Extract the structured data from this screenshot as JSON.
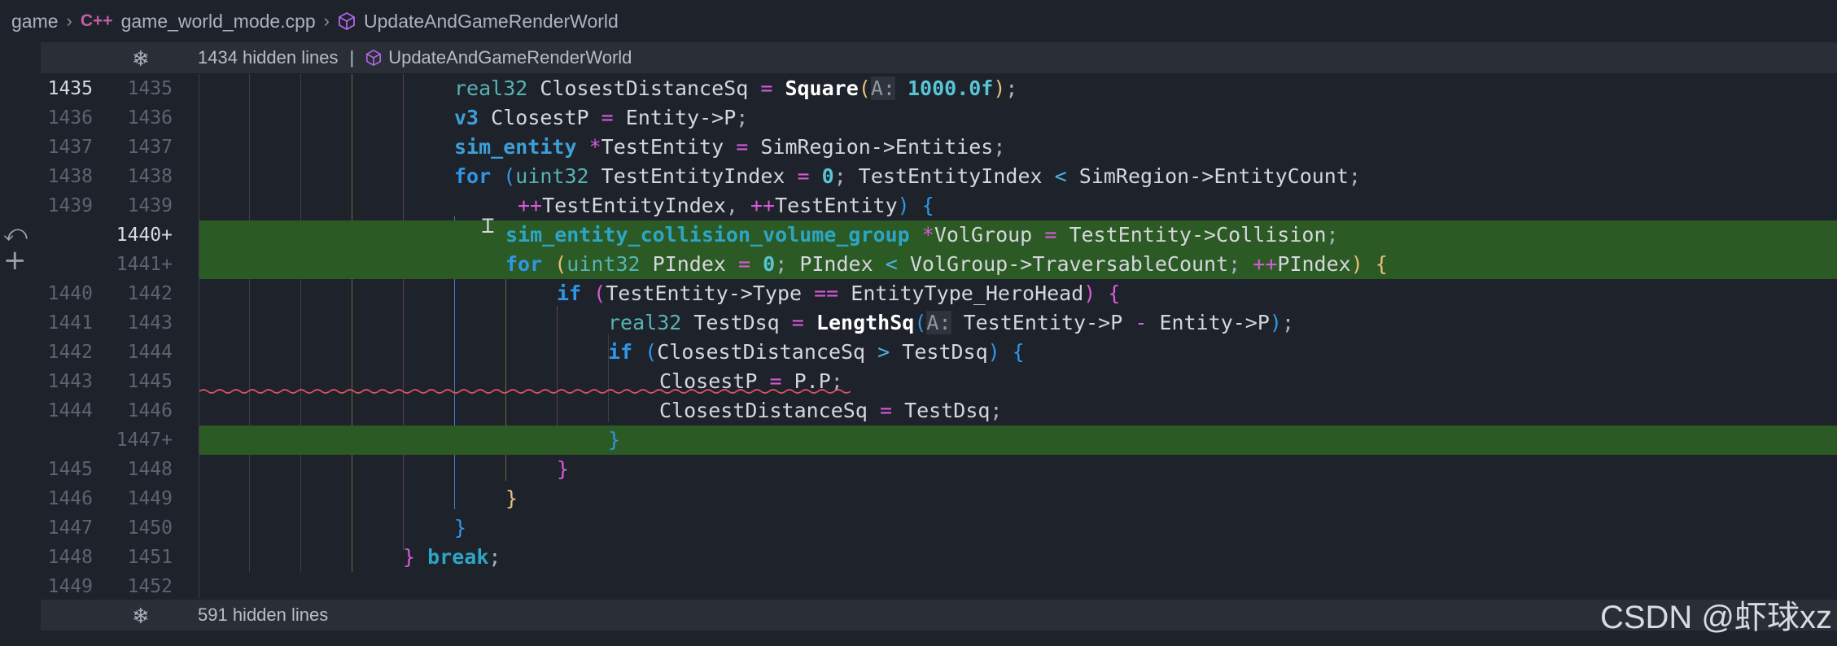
{
  "breadcrumb": {
    "folder": "game",
    "file_icon": "C++",
    "file": "game_world_mode.cpp",
    "symbol": "UpdateAndGameRenderWorld"
  },
  "top_fold": {
    "count_text": "1434 hidden lines",
    "separator": "|",
    "symbol": "UpdateAndGameRenderWorld"
  },
  "bottom_fold": {
    "count_text": "591 hidden lines"
  },
  "gutter_icons": [
    "revert-icon",
    "add-icon"
  ],
  "lines": [
    {
      "old": "1435",
      "new": "1435",
      "added": false,
      "current": true,
      "code": "real32 ClosestDistanceSq = Square(A: 1000.0f);"
    },
    {
      "old": "1436",
      "new": "1436",
      "added": false,
      "code": "v3 ClosestP = Entity->P;"
    },
    {
      "old": "1437",
      "new": "1437",
      "added": false,
      "code": "sim_entity *TestEntity = SimRegion->Entities;"
    },
    {
      "old": "1438",
      "new": "1438",
      "added": false,
      "code": "for (uint32 TestEntityIndex = 0; TestEntityIndex < SimRegion->EntityCount;"
    },
    {
      "old": "1439",
      "new": "1439",
      "added": false,
      "code": "++TestEntityIndex, ++TestEntity) {"
    },
    {
      "old": "",
      "new": "1440+",
      "added": true,
      "current": true,
      "code": "sim_entity_collision_volume_group *VolGroup = TestEntity->Collision;"
    },
    {
      "old": "",
      "new": "1441+",
      "added": true,
      "code": "for (uint32 PIndex = 0; PIndex < VolGroup->TraversableCount; ++PIndex) {"
    },
    {
      "old": "1440",
      "new": "1442",
      "added": false,
      "code": "if (TestEntity->Type == EntityType_HeroHead) {"
    },
    {
      "old": "1441",
      "new": "1443",
      "added": false,
      "code": "real32 TestDsq = LengthSq(A: TestEntity->P - Entity->P);"
    },
    {
      "old": "1442",
      "new": "1444",
      "added": false,
      "code": "if (ClosestDistanceSq > TestDsq) {"
    },
    {
      "old": "1443",
      "new": "1445",
      "added": false,
      "code": "ClosestP = P.P;"
    },
    {
      "old": "1444",
      "new": "1446",
      "added": false,
      "code": "ClosestDistanceSq = TestDsq;"
    },
    {
      "old": "",
      "new": "1447+",
      "added": true,
      "code": "}"
    },
    {
      "old": "1445",
      "new": "1448",
      "added": false,
      "code": "}"
    },
    {
      "old": "1446",
      "new": "1449",
      "added": false,
      "code": "}"
    },
    {
      "old": "1447",
      "new": "1450",
      "added": false,
      "code": "}"
    },
    {
      "old": "1448",
      "new": "1451",
      "added": false,
      "code": "} break;"
    },
    {
      "old": "1449",
      "new": "1452",
      "added": false,
      "code": ""
    }
  ],
  "watermark": "CSDN @虾球xz",
  "colors": {
    "background": "#1e222a",
    "added_line": "#2c5a24",
    "fold_bar": "#2a2f37",
    "error_squiggle": "#e05561"
  }
}
